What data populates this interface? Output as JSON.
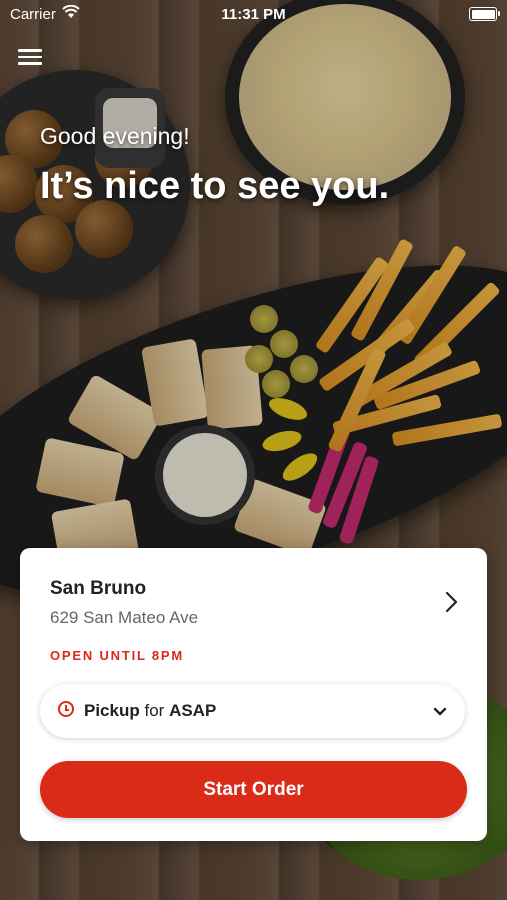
{
  "status_bar": {
    "carrier": "Carrier",
    "time": "11:31 PM"
  },
  "greeting": {
    "small": "Good evening!",
    "big": "It’s nice to see you."
  },
  "location": {
    "name": "San Bruno",
    "address": "629 San Mateo Ave",
    "hours_status": "OPEN UNTIL 8PM"
  },
  "order_mode": {
    "mode": "Pickup",
    "connector": "for",
    "time": "ASAP"
  },
  "start_order_label": "Start Order",
  "colors": {
    "accent": "#d92b17",
    "card": "#ffffff",
    "text": "#222222",
    "subtext": "#666666"
  },
  "icons": [
    "menu-icon",
    "wifi-icon",
    "battery-icon",
    "chevron-right-icon",
    "clock-icon",
    "chevron-down-icon"
  ]
}
